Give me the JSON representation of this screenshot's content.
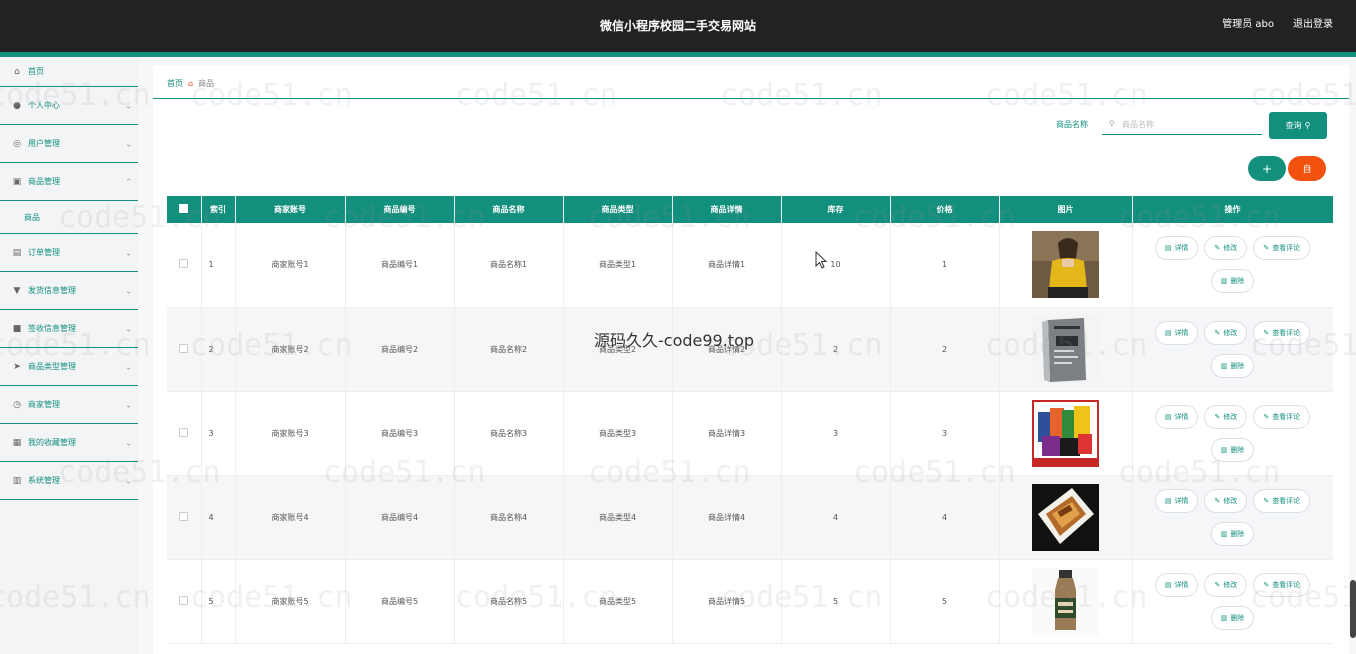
{
  "header": {
    "title": "微信小程序校园二手交易网站",
    "user": "管理员 abo",
    "logout": "退出登录"
  },
  "sidebar": {
    "items": [
      {
        "label": "首页",
        "icon": "home-icon"
      },
      {
        "label": "个人中心",
        "icon": "user-icon"
      },
      {
        "label": "用户管理",
        "icon": "people-icon"
      },
      {
        "label": "商品管理",
        "icon": "shop-icon",
        "expanded": true,
        "children": [
          "商品"
        ]
      },
      {
        "label": "订单管理",
        "icon": "order-icon"
      },
      {
        "label": "发货信息管理",
        "icon": "truck-icon"
      },
      {
        "label": "签收信息管理",
        "icon": "sign-icon"
      },
      {
        "label": "商品类型管理",
        "icon": "send-icon"
      },
      {
        "label": "商家管理",
        "icon": "clock-icon"
      },
      {
        "label": "我的收藏管理",
        "icon": "fav-icon"
      },
      {
        "label": "系统管理",
        "icon": "chart-icon"
      }
    ]
  },
  "breadcrumb": {
    "home": "首页",
    "current": "商品"
  },
  "search": {
    "label": "商品名称",
    "placeholder": "商品名称",
    "button": "查询"
  },
  "actions": {
    "add": "+",
    "delete": "自"
  },
  "table": {
    "columns": [
      "索引",
      "商家账号",
      "商品编号",
      "商品名称",
      "商品类型",
      "商品详情",
      "库存",
      "价格",
      "图片",
      "操作"
    ],
    "rows": [
      {
        "index": "1",
        "merchant": "商家账号1",
        "code": "商品编号1",
        "name": "商品名称1",
        "type": "商品类型1",
        "detail": "商品详情1",
        "stock": "10",
        "price": "1",
        "img": "clothing"
      },
      {
        "index": "2",
        "merchant": "商家账号2",
        "code": "商品编号2",
        "name": "商品名称2",
        "type": "商品类型2",
        "detail": "商品详情2",
        "stock": "2",
        "price": "2",
        "img": "book"
      },
      {
        "index": "3",
        "merchant": "商家账号3",
        "code": "商品编号3",
        "name": "商品名称3",
        "type": "商品类型3",
        "detail": "商品详情3",
        "stock": "3",
        "price": "3",
        "img": "snacks"
      },
      {
        "index": "4",
        "merchant": "商家账号4",
        "code": "商品编号4",
        "name": "商品名称4",
        "type": "商品类型4",
        "detail": "商品详情4",
        "stock": "4",
        "price": "4",
        "img": "food"
      },
      {
        "index": "5",
        "merchant": "商家账号5",
        "code": "商品编号5",
        "name": "商品名称5",
        "type": "商品类型5",
        "detail": "商品详情5",
        "stock": "5",
        "price": "5",
        "img": "drink"
      }
    ],
    "ops": {
      "detail": "详情",
      "edit": "修改",
      "comment": "查看评论",
      "delete": "删除"
    }
  },
  "watermark": {
    "text": "code51.cn",
    "center": "源码久久-code99.top"
  },
  "colors": {
    "primary": "#138f7e",
    "danger": "#f3510f",
    "topbar": "#222222"
  }
}
